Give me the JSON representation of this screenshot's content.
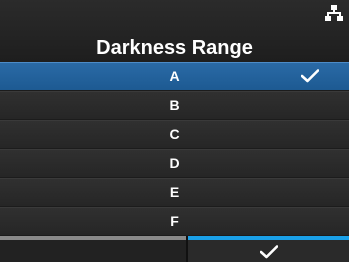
{
  "header": {
    "title": "Darkness Range",
    "icons": {
      "network": "network-icon"
    }
  },
  "list": {
    "selected_index": 0,
    "items": [
      {
        "label": "A",
        "selected": true
      },
      {
        "label": "B",
        "selected": false
      },
      {
        "label": "C",
        "selected": false
      },
      {
        "label": "D",
        "selected": false
      },
      {
        "label": "E",
        "selected": false
      },
      {
        "label": "F",
        "selected": false
      }
    ]
  },
  "footer": {
    "left_button": {
      "label": ""
    },
    "right_button": {
      "icon": "check-icon"
    }
  },
  "colors": {
    "background": "#1c1c1c",
    "selected_row": "#2a6aa6",
    "row": "#2c2c2c",
    "accent_blue": "#1aa0e8",
    "inactive_bar": "#8a8a8a",
    "text": "#ffffff"
  }
}
